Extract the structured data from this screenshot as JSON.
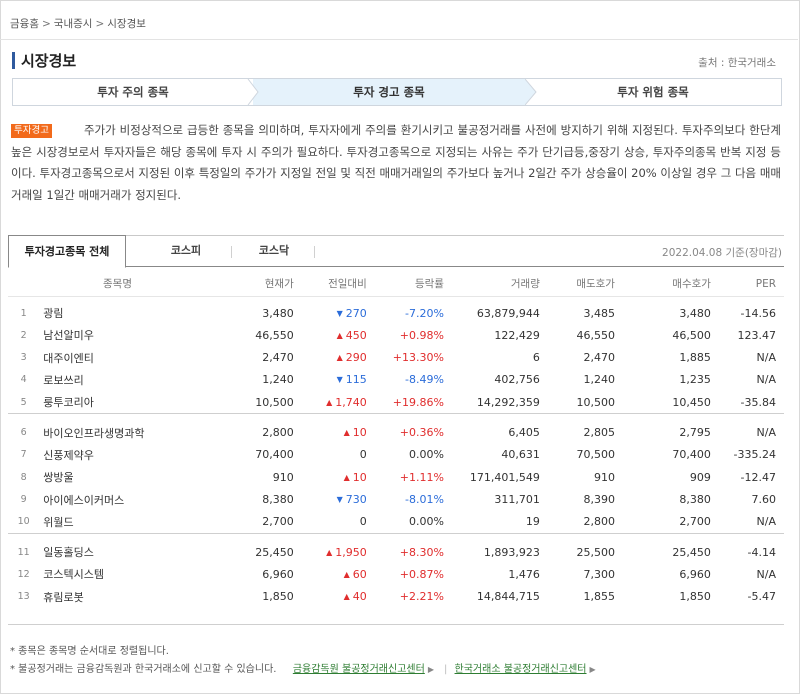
{
  "breadcrumb": [
    "금융홈",
    "국내증시",
    "시장경보"
  ],
  "title": "시장경보",
  "source": "출처 : 한국거래소",
  "steps": [
    "투자 주의 종목",
    "투자 경고 종목",
    "투자 위험 종목"
  ],
  "badge": "투자경고",
  "description": "주가가 비정상적으로 급등한 종목을 의미하며, 투자자에게 주의를 환기시키고 불공정거래를 사전에 방지하기 위해 지정된다. 투자주의보다 한단계 높은 시장경보로서 투자자들은 해당 종목에 투자 시 주의가 필요하다. 투자경고종목으로 지정되는 사유는 주가 단기급등,중장기 상승, 투자주의종목 반복 지정 등이다. 투자경고종목으로서 지정된 이후 특정일의 주가가 지정일 전일 및 직전 매매거래일의 주가보다 높거나 2일간 주가 상승율이 20% 이상일 경우 그 다음 매매거래일 1일간 매매거래가 정지된다.",
  "tabs": [
    "투자경고종목 전체",
    "코스피",
    "코스닥"
  ],
  "date_note": "2022.04.08 기준(장마감)",
  "columns": [
    "종목명",
    "현재가",
    "전일대비",
    "등락률",
    "거래량",
    "매도호가",
    "매수호가",
    "PER"
  ],
  "rows": [
    {
      "no": "1",
      "name": "광림",
      "price": "3,480",
      "dir": "down",
      "change": "270",
      "rate": "-7.20%",
      "volume": "63,879,944",
      "ask": "3,485",
      "bid": "3,480",
      "per": "-14.56"
    },
    {
      "no": "2",
      "name": "남선알미우",
      "price": "46,550",
      "dir": "up",
      "change": "450",
      "rate": "+0.98%",
      "volume": "122,429",
      "ask": "46,550",
      "bid": "46,500",
      "per": "123.47"
    },
    {
      "no": "3",
      "name": "대주이엔티",
      "price": "2,470",
      "dir": "up",
      "change": "290",
      "rate": "+13.30%",
      "volume": "6",
      "ask": "2,470",
      "bid": "1,885",
      "per": "N/A"
    },
    {
      "no": "4",
      "name": "로보쓰리",
      "price": "1,240",
      "dir": "down",
      "change": "115",
      "rate": "-8.49%",
      "volume": "402,756",
      "ask": "1,240",
      "bid": "1,235",
      "per": "N/A"
    },
    {
      "no": "5",
      "name": "룽투코리아",
      "price": "10,500",
      "dir": "up",
      "change": "1,740",
      "rate": "+19.86%",
      "volume": "14,292,359",
      "ask": "10,500",
      "bid": "10,450",
      "per": "-35.84"
    },
    {
      "no": "6",
      "name": "바이오인프라생명과학",
      "price": "2,800",
      "dir": "up",
      "change": "10",
      "rate": "+0.36%",
      "volume": "6,405",
      "ask": "2,805",
      "bid": "2,795",
      "per": "N/A"
    },
    {
      "no": "7",
      "name": "신풍제약우",
      "price": "70,400",
      "dir": "flat",
      "change": "0",
      "rate": "0.00%",
      "volume": "40,631",
      "ask": "70,500",
      "bid": "70,400",
      "per": "-335.24"
    },
    {
      "no": "8",
      "name": "쌍방울",
      "price": "910",
      "dir": "up",
      "change": "10",
      "rate": "+1.11%",
      "volume": "171,401,549",
      "ask": "910",
      "bid": "909",
      "per": "-12.47"
    },
    {
      "no": "9",
      "name": "아이에스이커머스",
      "price": "8,380",
      "dir": "down",
      "change": "730",
      "rate": "-8.01%",
      "volume": "311,701",
      "ask": "8,390",
      "bid": "8,380",
      "per": "7.60"
    },
    {
      "no": "10",
      "name": "위월드",
      "price": "2,700",
      "dir": "flat",
      "change": "0",
      "rate": "0.00%",
      "volume": "19",
      "ask": "2,800",
      "bid": "2,700",
      "per": "N/A"
    },
    {
      "no": "11",
      "name": "일동홀딩스",
      "price": "25,450",
      "dir": "up",
      "change": "1,950",
      "rate": "+8.30%",
      "volume": "1,893,923",
      "ask": "25,500",
      "bid": "25,450",
      "per": "-4.14"
    },
    {
      "no": "12",
      "name": "코스텍시스템",
      "price": "6,960",
      "dir": "up",
      "change": "60",
      "rate": "+0.87%",
      "volume": "1,476",
      "ask": "7,300",
      "bid": "6,960",
      "per": "N/A"
    },
    {
      "no": "13",
      "name": "휴림로봇",
      "price": "1,850",
      "dir": "up",
      "change": "40",
      "rate": "+2.21%",
      "volume": "14,844,715",
      "ask": "1,855",
      "bid": "1,850",
      "per": "-5.47"
    }
  ],
  "notes": {
    "note1": "* 종목은 종목명 순서대로 정렬됩니다.",
    "note2": "* 불공정거래는 금융감독원과 한국거래소에 신고할 수 있습니다.",
    "link1": "금융감독원 불공정거래신고센터",
    "link2": "한국거래소 불공정거래신고센터"
  },
  "colors": {
    "up": "#e02d2d",
    "down": "#2b6cd9",
    "badge": "#f26a1b",
    "accent": "#2f5a9e"
  }
}
